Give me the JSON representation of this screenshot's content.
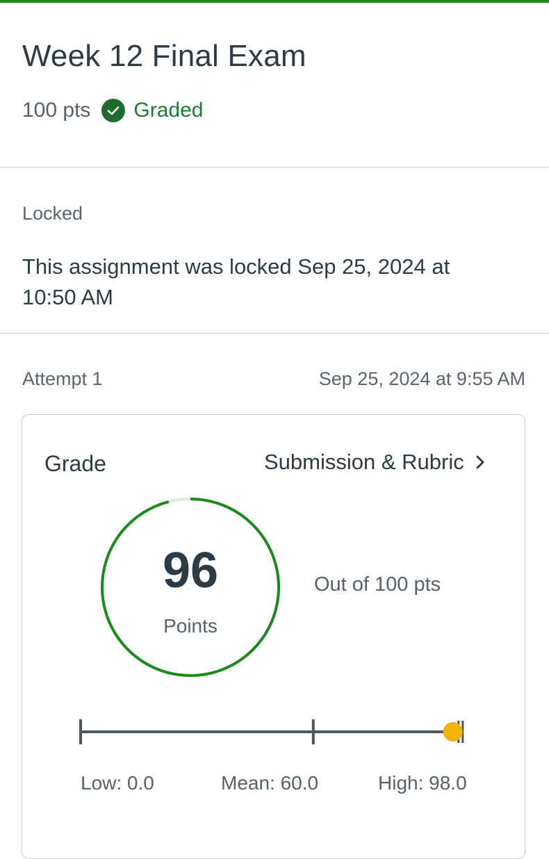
{
  "assignment": {
    "title": "Week 12 Final Exam",
    "points_possible": "100 pts",
    "status": "Graded"
  },
  "lock": {
    "label": "Locked",
    "message": "This assignment was locked Sep 25, 2024 at 10:50 AM"
  },
  "attempt": {
    "label": "Attempt 1",
    "date": "Sep 25, 2024 at 9:55 AM"
  },
  "grade": {
    "heading": "Grade",
    "link_label": "Submission & Rubric",
    "score": "96",
    "score_unit": "Points",
    "out_of": "Out of 100 pts",
    "fraction": 0.96
  },
  "statistics": {
    "low_label": "Low: 0.0",
    "mean_label": "Mean: 60.0",
    "high_label": "High: 98.0",
    "low": 0.0,
    "mean": 60.0,
    "high": 98.0,
    "user_score": 96,
    "max": 100
  },
  "colors": {
    "accent_green": "#1a8a1a",
    "ring_green": "#1a8a1a",
    "ring_track": "#d8ecd8",
    "check_badge": "#1f6b2e",
    "marker_yellow": "#f2b400",
    "bar_slate": "#4a5660"
  },
  "icons": {
    "status": "check-circle-icon",
    "link": "chevron-right-icon",
    "score_marker": "dot-marker-icon"
  }
}
